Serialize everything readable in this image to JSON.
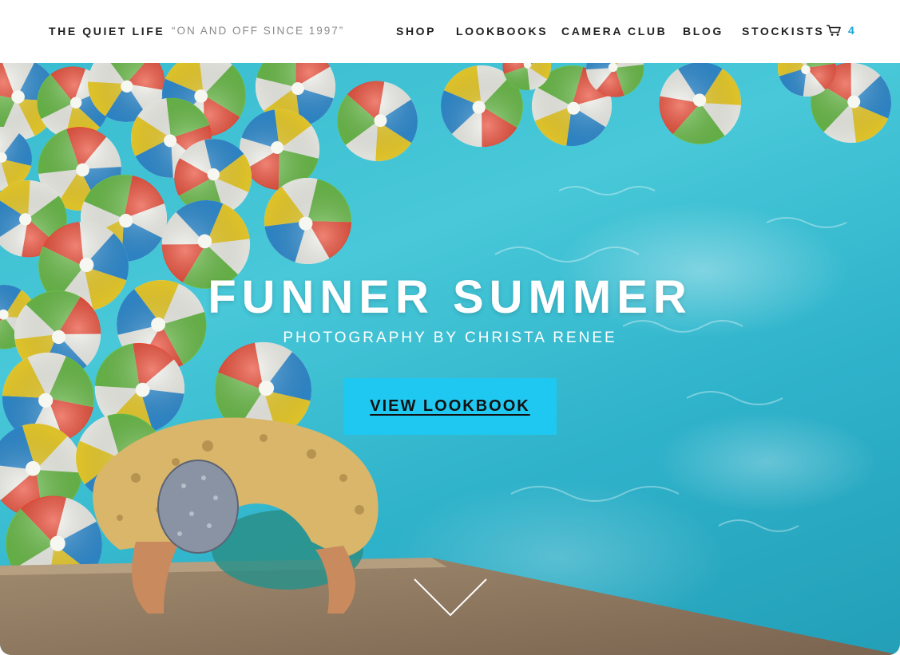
{
  "header": {
    "brand": "THE QUIET LIFE",
    "tagline": "“ON AND OFF SINCE 1997”",
    "nav": [
      "SHOP",
      "LOOKBOOKS",
      "CAMERA CLUB",
      "BLOG",
      "STOCKISTS"
    ],
    "cart_icon": "shopping-cart-icon",
    "cart_count": "4"
  },
  "hero": {
    "title": "FUNNER SUMMER",
    "subtitle": "PHOTOGRAPHY BY CHRISTA RENEE",
    "cta_label": "VIEW LOOKBOOK",
    "scroll_icon": "chevron-down-icon"
  },
  "colors": {
    "accent": "#1ec8f0",
    "cart_count": "#1aa4d9",
    "pool": "#39bcd0",
    "nav_text": "#222222"
  }
}
